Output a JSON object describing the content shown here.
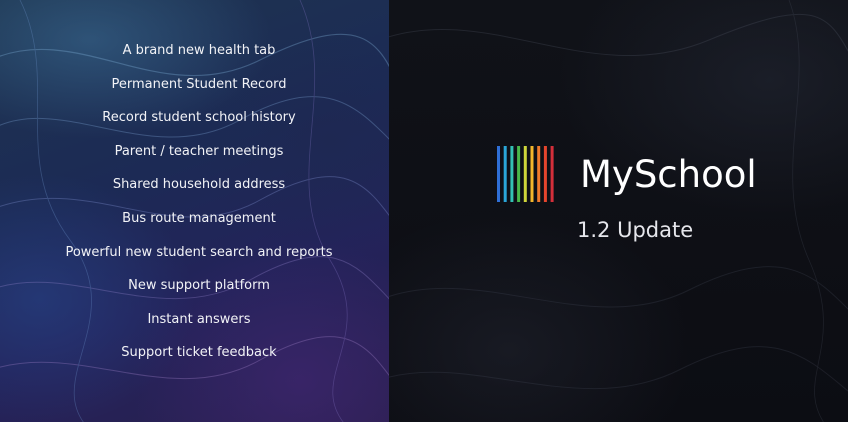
{
  "features": [
    "A brand new health tab",
    "Permanent Student Record",
    "Record student school history",
    "Parent / teacher meetings",
    "Shared household address",
    "Bus route management",
    "Powerful new student search and reports",
    "New support platform",
    "Instant answers",
    "Support ticket feedback"
  ],
  "brand": {
    "name": "MySchool",
    "version": "1.2 Update",
    "logo_icon": "rainbow-bars-logo-icon",
    "logo_colors": [
      "#2f6fd6",
      "#2aa6d8",
      "#33c1b4",
      "#49b84a",
      "#cfd63a",
      "#f3b62b",
      "#ef7b2c",
      "#e6452d",
      "#d42f3a"
    ]
  },
  "colors": {
    "left_background": "#1e2f55",
    "right_background": "#0e1016",
    "text": "#ffffff"
  }
}
